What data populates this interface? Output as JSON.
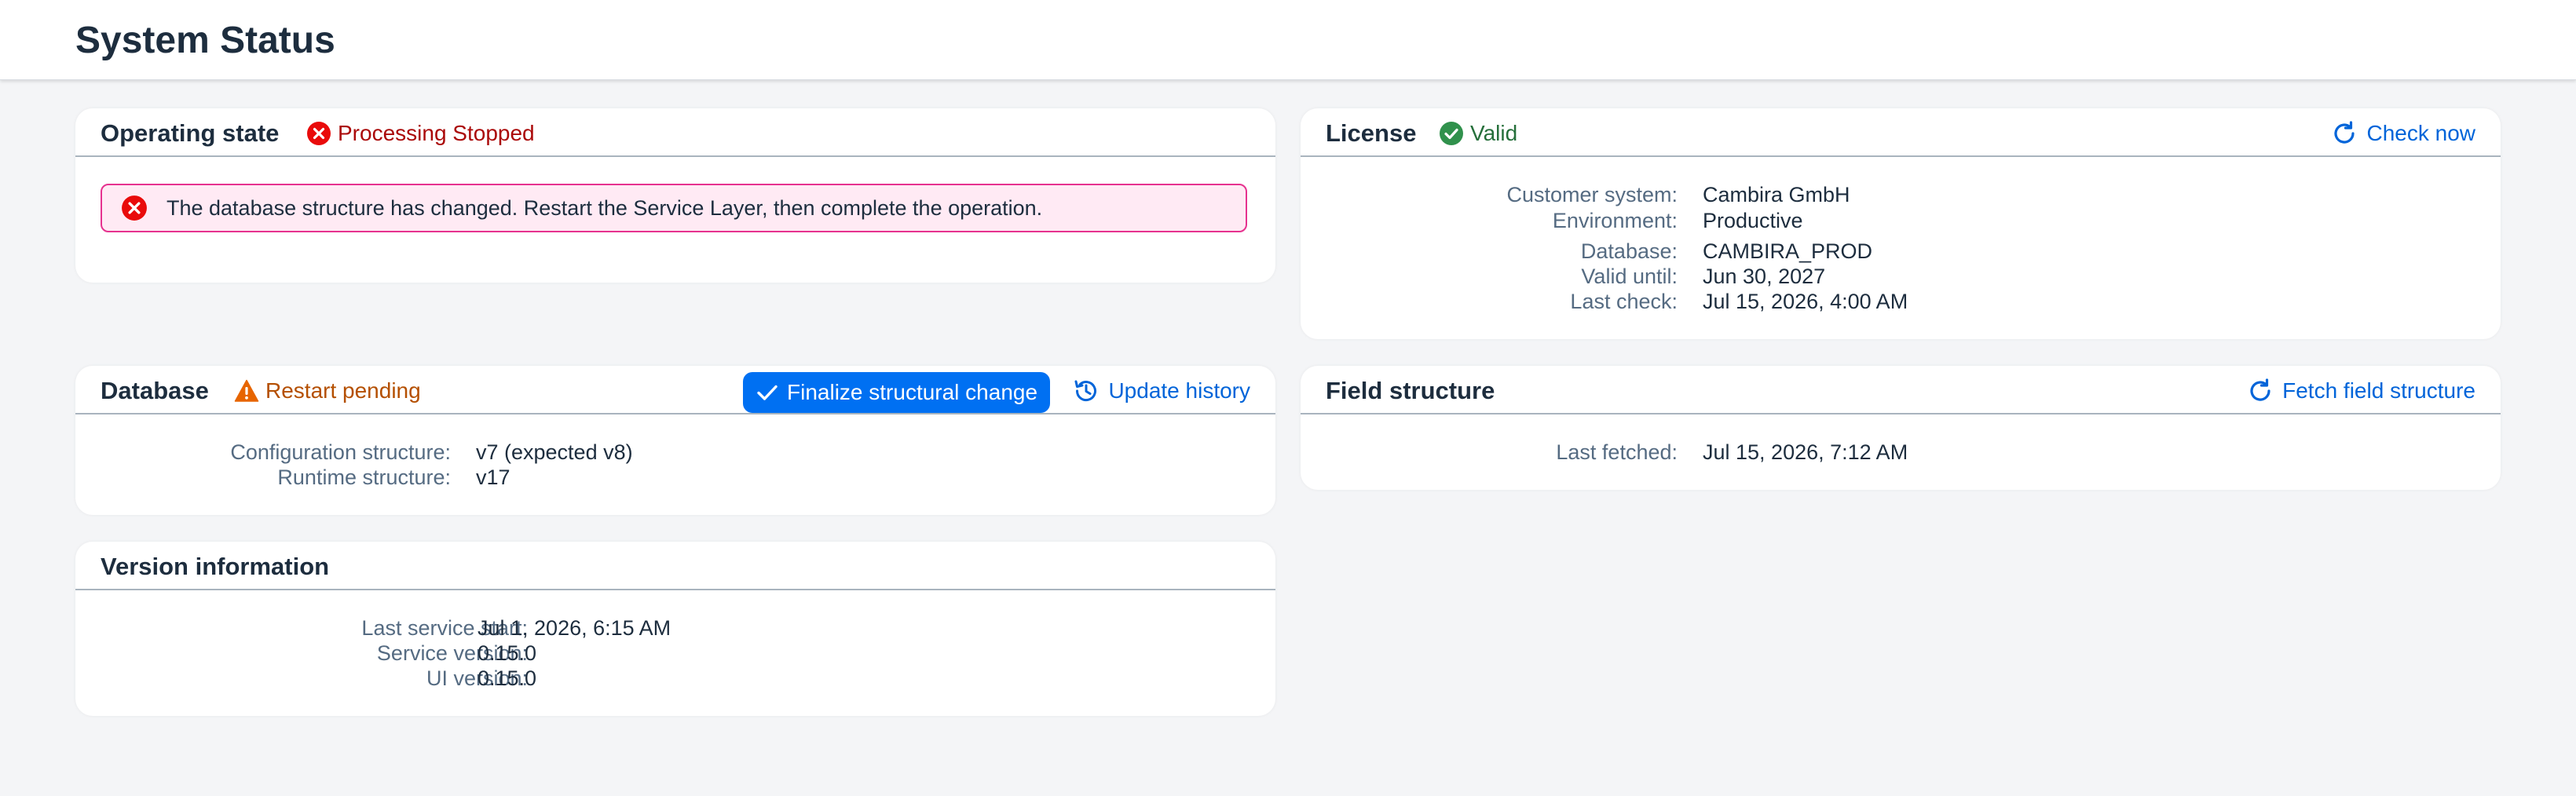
{
  "page": {
    "title": "System Status"
  },
  "operating_state": {
    "title": "Operating state",
    "status": "Processing Stopped",
    "message": "The database structure has changed. Restart the Service Layer, then complete the operation."
  },
  "license": {
    "title": "License",
    "status": "Valid",
    "check_label": "Check now",
    "fields": [
      {
        "label": "Customer system:",
        "value": "Cambira GmbH"
      },
      {
        "label": "Environment:",
        "value": "Productive"
      },
      {
        "label": "Database:",
        "value": "CAMBIRA_PROD"
      },
      {
        "label": "Valid until:",
        "value": "Jun 30, 2027"
      },
      {
        "label": "Last check:",
        "value": "Jul 15, 2026, 4:00 AM"
      }
    ]
  },
  "database": {
    "title": "Database",
    "status": "Restart pending",
    "finalize_label": "Finalize structural change",
    "history_label": "Update history",
    "fields": [
      {
        "label": "Configuration structure:",
        "value": "v7 (expected v8)"
      },
      {
        "label": "Runtime structure:",
        "value": "v17"
      }
    ]
  },
  "field_structure": {
    "title": "Field structure",
    "fetch_label": "Fetch field structure",
    "fields": [
      {
        "label": "Last fetched:",
        "value": "Jul 15, 2026, 7:12 AM"
      }
    ]
  },
  "version_info": {
    "title": "Version information",
    "fields": [
      {
        "label": "Last service start:",
        "value": "Jul 1, 2026, 6:15 AM"
      },
      {
        "label": "Service version:",
        "value": "0.15.0"
      },
      {
        "label": "UI version:",
        "value": "0.15.0"
      }
    ]
  },
  "colors": {
    "error": "#aa0808",
    "success": "#256f3a",
    "warning": "#b44f00",
    "link": "#0064d9",
    "primary": "#0070f2"
  },
  "icons": {
    "operating_state": "error-circle-icon",
    "license": "check-circle-icon",
    "database": "warning-triangle-icon",
    "check_now": "refresh-icon",
    "finalize": "checkmark-icon",
    "history": "history-icon",
    "fetch": "refresh-icon"
  }
}
